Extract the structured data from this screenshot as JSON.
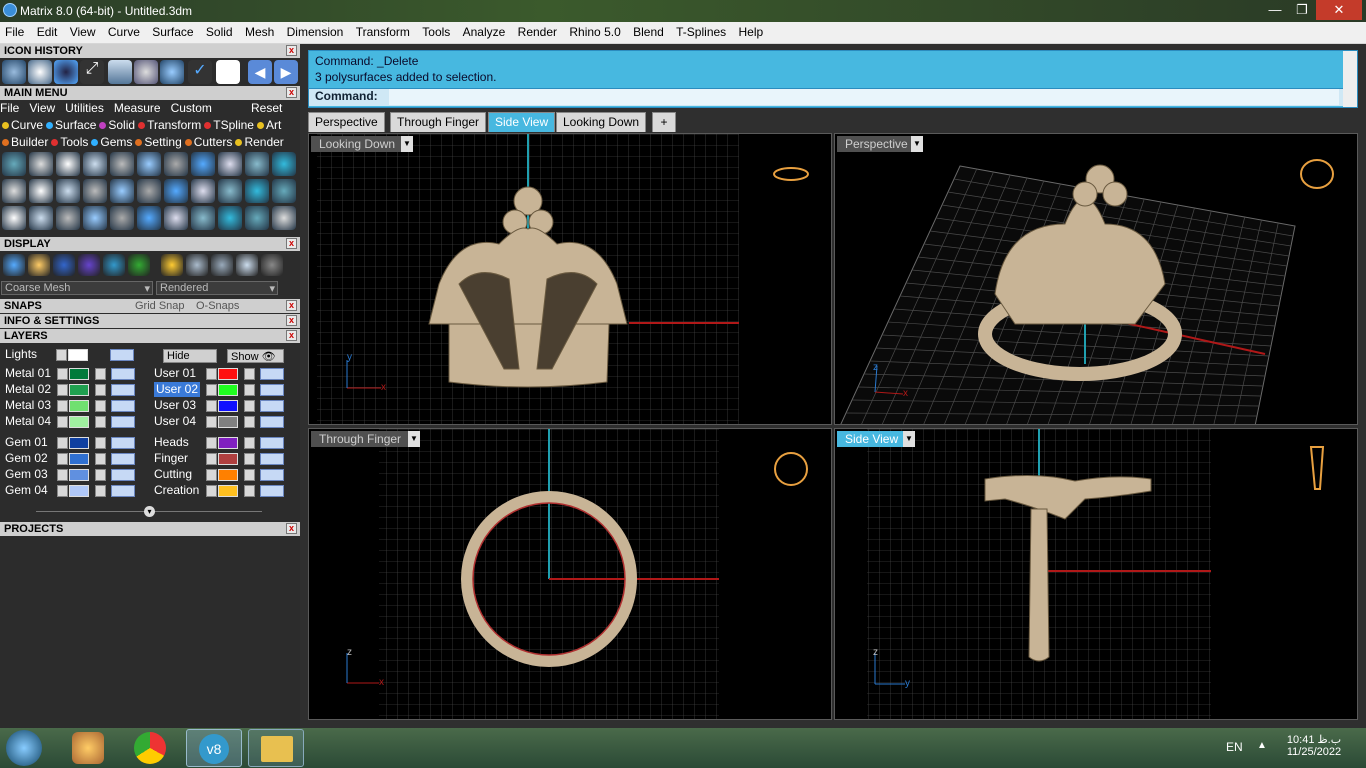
{
  "window": {
    "title": "Matrix 8.0 (64-bit) - Untitled.3dm"
  },
  "menu": [
    "File",
    "Edit",
    "View",
    "Curve",
    "Surface",
    "Solid",
    "Mesh",
    "Dimension",
    "Transform",
    "Tools",
    "Analyze",
    "Render",
    "Rhino 5.0",
    "Blend",
    "T-Splines",
    "Help"
  ],
  "panels": {
    "icon_history": "ICON HISTORY",
    "main_menu": "MAIN MENU",
    "display": "DISPLAY",
    "snaps": "SNAPS",
    "info": "INFO & SETTINGS",
    "layers": "LAYERS",
    "projects": "PROJECTS"
  },
  "main_menu_links": [
    "File",
    "View",
    "Utilities",
    "Measure",
    "Custom"
  ],
  "main_menu_reset": "Reset",
  "tool_row1": [
    {
      "label": "Curve",
      "color": "#e8c020"
    },
    {
      "label": "Surface",
      "color": "#30b0ff"
    },
    {
      "label": "Solid",
      "color": "#c040c0"
    },
    {
      "label": "Transform",
      "color": "#e03030"
    },
    {
      "label": "TSpline",
      "color": "#e03030"
    },
    {
      "label": "Art",
      "color": "#e8c020"
    }
  ],
  "tool_row2": [
    {
      "label": "Builder",
      "color": "#e07020"
    },
    {
      "label": "Tools",
      "color": "#e03030"
    },
    {
      "label": "Gems",
      "color": "#30b0ff"
    },
    {
      "label": "Setting",
      "color": "#e07020"
    },
    {
      "label": "Cutters",
      "color": "#e07020"
    },
    {
      "label": "Render",
      "color": "#e8c020"
    }
  ],
  "display": {
    "mesh": "Coarse Mesh",
    "mode": "Rendered"
  },
  "snaps": {
    "grid": "Grid Snap",
    "osnap": "O-Snaps"
  },
  "layers": {
    "lights": "Lights",
    "hide": "Hide",
    "show": "Show",
    "left": [
      {
        "name": "Metal 01",
        "color": "#007a3a"
      },
      {
        "name": "Metal 02",
        "color": "#20a050"
      },
      {
        "name": "Metal 03",
        "color": "#70e070"
      },
      {
        "name": "Metal 04",
        "color": "#a0f0a0"
      },
      {
        "name": "Gem 01",
        "color": "#1040a0"
      },
      {
        "name": "Gem 02",
        "color": "#3070d0"
      },
      {
        "name": "Gem 03",
        "color": "#6090e0"
      },
      {
        "name": "Gem 04",
        "color": "#b0c8f8"
      }
    ],
    "right": [
      {
        "name": "User 01",
        "color": "#ff1010"
      },
      {
        "name": "User 02",
        "color": "#20ff20"
      },
      {
        "name": "User 03",
        "color": "#1010ff"
      },
      {
        "name": "User 04",
        "color": "#808080"
      },
      {
        "name": "Heads",
        "color": "#8020c0"
      },
      {
        "name": "Finger",
        "color": "#b04040"
      },
      {
        "name": "Cutting",
        "color": "#ff8000"
      },
      {
        "name": "Creation",
        "color": "#ffc020"
      }
    ]
  },
  "command": {
    "line1": "Command: _Delete",
    "line2": "3 polysurfaces added to selection.",
    "prompt": "Command:"
  },
  "tabs": [
    "Perspective",
    "Through Finger",
    "Side View",
    "Looking Down"
  ],
  "active_tab": "Side View",
  "viewports": {
    "tl": "Looking Down",
    "tr": "Perspective",
    "bl": "Through Finger",
    "br": "Side View"
  },
  "axes": {
    "x": "x",
    "y": "y",
    "z": "z"
  },
  "taskbar": {
    "lang": "EN",
    "time": "10:41 ب.ظ",
    "date": "11/25/2022"
  }
}
